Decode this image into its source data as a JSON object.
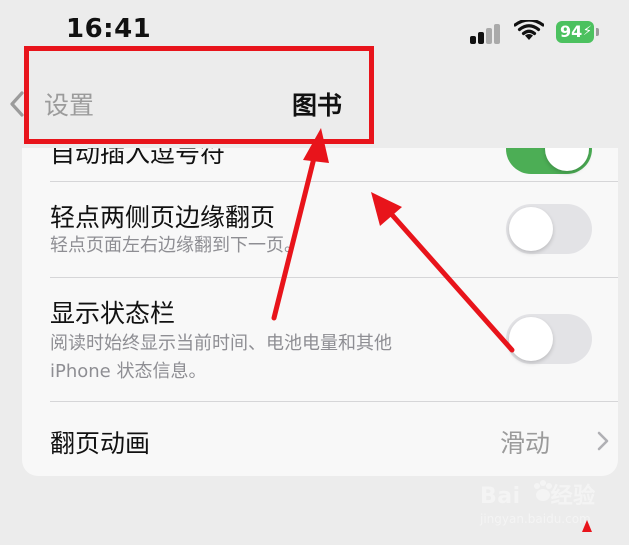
{
  "status_bar": {
    "time": "16:41",
    "battery": "94"
  },
  "nav": {
    "back_label": "设置",
    "title": "图书"
  },
  "settings": {
    "partial_row_title": "自动插入逗号符",
    "page_turn_tap": {
      "title": "轻点两侧页边缘翻页",
      "subtitle": "轻点页面左右边缘翻到下一页。",
      "enabled": false
    },
    "status_bar_toggle": {
      "title": "显示状态栏",
      "subtitle_line1": "阅读时始终显示当前时间、电池电量和其他",
      "subtitle_line2": "iPhone 状态信息。",
      "enabled": false
    },
    "page_animation": {
      "title": "翻页动画",
      "value": "滑动"
    }
  },
  "watermark": {
    "logo_part1": "Bai",
    "logo_part2": "经验",
    "url": "jingyan.baidu.com"
  },
  "colors": {
    "accent_red": "#e8141b",
    "toggle_on": "#4cae55",
    "battery": "#4cc15f"
  }
}
